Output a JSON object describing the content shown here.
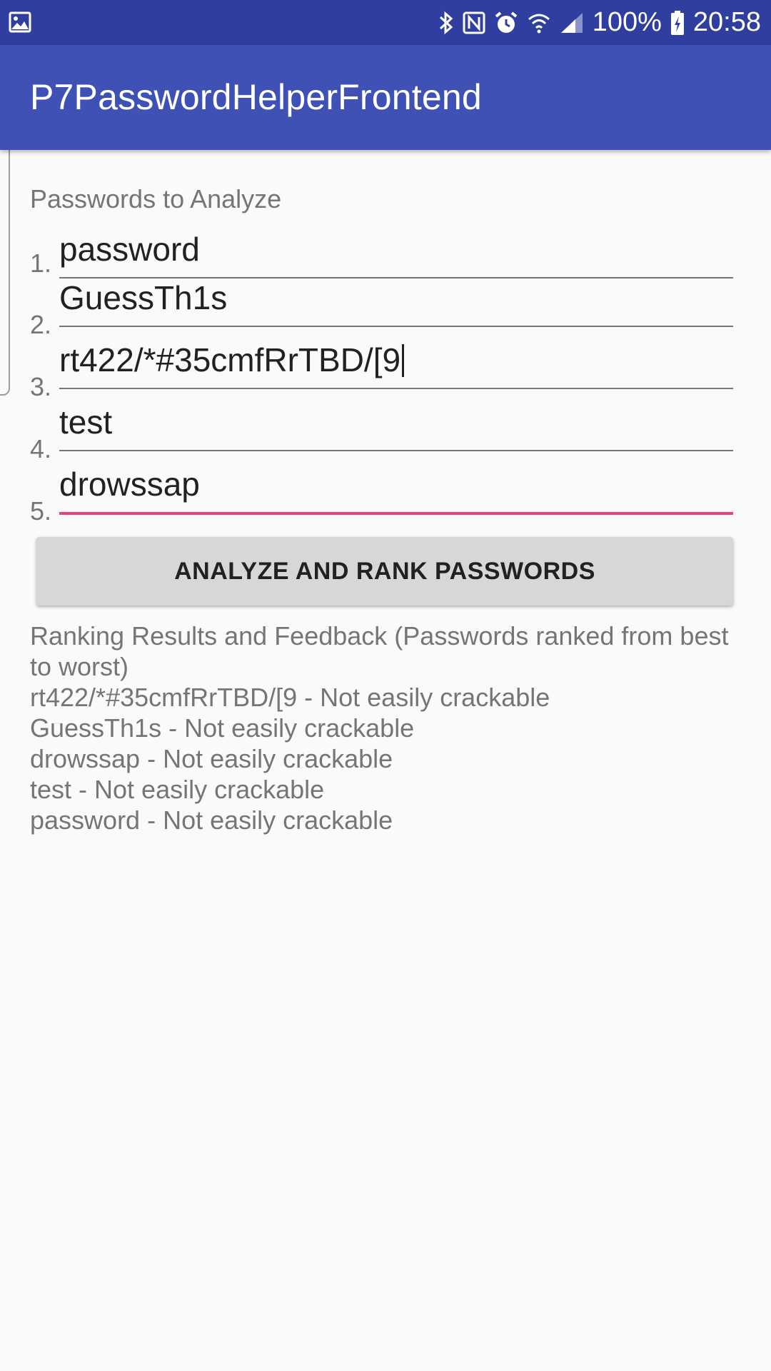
{
  "status_bar": {
    "battery": "100%",
    "time": "20:58",
    "icons": [
      "image-icon",
      "bluetooth-icon",
      "nfc-icon",
      "alarm-icon",
      "wifi-icon",
      "signal-icon",
      "battery-charging-icon"
    ]
  },
  "app_bar": {
    "title": "P7PasswordHelperFrontend"
  },
  "form": {
    "section_label": "Passwords to Analyze",
    "passwords": [
      {
        "number": "1.",
        "value": "password"
      },
      {
        "number": "2.",
        "value": "GuessTh1s"
      },
      {
        "number": "3.",
        "value": "rt422/*#35cmfRrTBD/[9"
      },
      {
        "number": "4.",
        "value": "test"
      },
      {
        "number": "5.",
        "value": "drowssap"
      }
    ],
    "analyze_button": "ANALYZE AND RANK PASSWORDS"
  },
  "results": {
    "heading": "Ranking Results and Feedback (Passwords ranked from best to worst)",
    "lines": [
      "rt422/*#35cmfRrTBD/[9 - Not easily crackable",
      "GuessTh1s - Not easily crackable",
      "drowssap - Not easily crackable",
      "test - Not easily crackable",
      "password - Not easily crackable"
    ]
  },
  "colors": {
    "status_bar": "#303f9f",
    "app_bar": "#3f51b5",
    "accent": "#ec407a",
    "background": "#fafafa"
  }
}
